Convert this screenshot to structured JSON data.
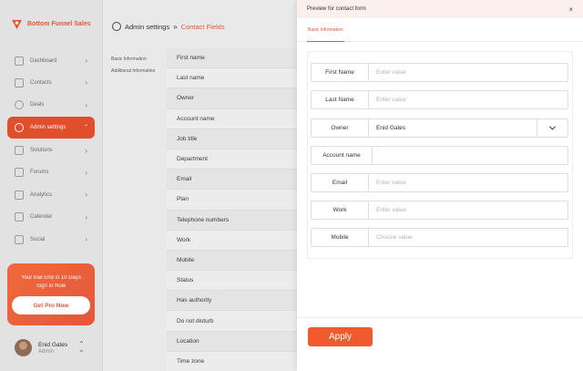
{
  "brand": {
    "name": "Bottom Funnel Sales",
    "accent": "#e05a3a"
  },
  "sidebar": {
    "items": [
      {
        "label": "Dashboard",
        "icon": "chart-icon"
      },
      {
        "label": "Contacts",
        "icon": "contacts-icon"
      },
      {
        "label": "Deals",
        "icon": "dollar-icon"
      },
      {
        "label": "Admin settings",
        "icon": "admin-icon",
        "active": true
      },
      {
        "label": "Solutions",
        "icon": "solutions-icon"
      },
      {
        "label": "Forums",
        "icon": "forums-icon"
      },
      {
        "label": "Analytics",
        "icon": "analytics-icon"
      },
      {
        "label": "Calendar",
        "icon": "calendar-icon"
      },
      {
        "label": "Social",
        "icon": "social-icon"
      }
    ]
  },
  "trial": {
    "text_line1": "Your trail End in 10 Days",
    "text_line2": "Sign In Now",
    "button": "Get Pro Now"
  },
  "user": {
    "name": "Enid Gates",
    "role": "Admin"
  },
  "breadcrumb": {
    "root": "Admin settings",
    "separator": "»",
    "leaf": "Contact Fields"
  },
  "subnav": [
    "Basic Information",
    "Additional Information"
  ],
  "fields": [
    "First name",
    "Last name",
    "Owner",
    "Account name",
    "Job title",
    "Department",
    "Email",
    "Plan",
    "Telephone numbers",
    "Work",
    "Mobile",
    "Status",
    "Has authority",
    "Do not disturb",
    "Location",
    "Time zone"
  ],
  "modal": {
    "title": "Preview for contact form",
    "close": "×",
    "tab": "Basic Information",
    "form": {
      "first_name": {
        "label": "First Name",
        "placeholder": "Enter value"
      },
      "last_name": {
        "label": "Last Name",
        "placeholder": "Enter value"
      },
      "owner": {
        "label": "Owner",
        "value": "Enid Gates"
      },
      "account_name": {
        "label": "Account name",
        "value": ""
      },
      "email": {
        "label": "Email",
        "placeholder": "Enter value"
      },
      "work": {
        "label": "Work",
        "placeholder": "Enter value"
      },
      "mobile": {
        "label": "Mobile",
        "placeholder": "Choose value"
      }
    },
    "apply": "Apply"
  }
}
